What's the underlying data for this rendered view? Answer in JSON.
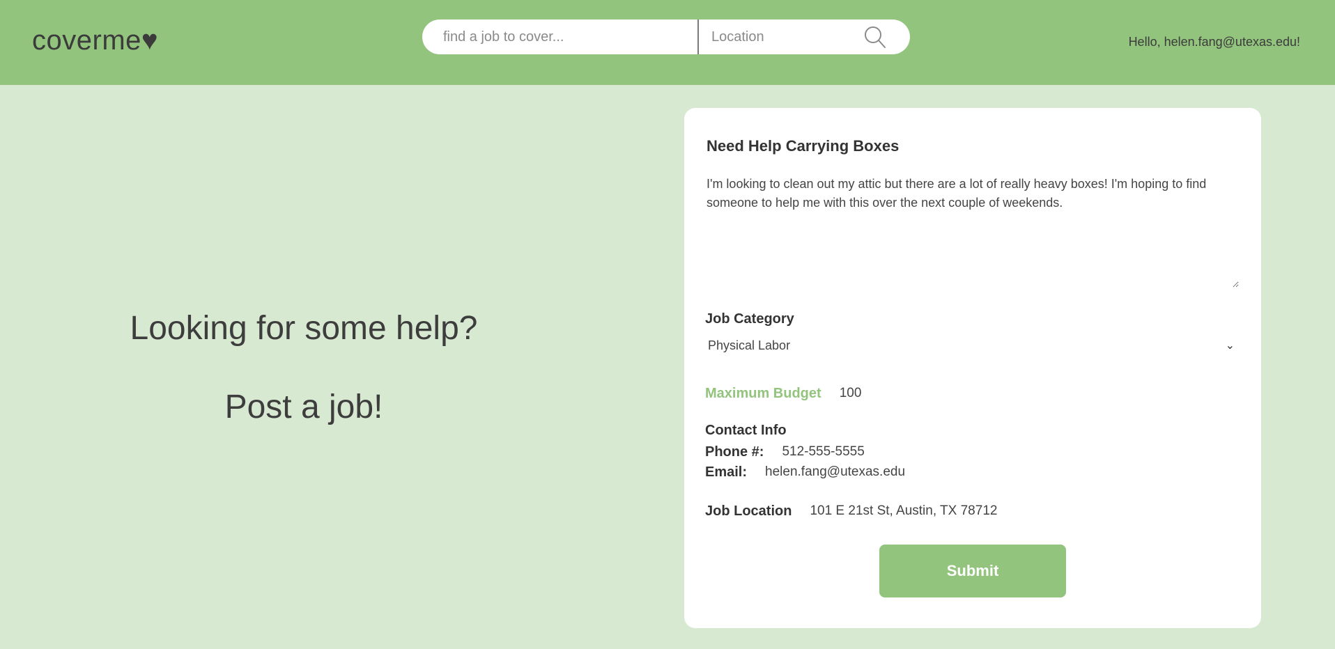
{
  "header": {
    "logo": "coverme♥",
    "search_placeholder": "find a job to cover...",
    "location_placeholder": "Location",
    "search_icon": "search-icon",
    "greeting": "Hello, helen.fang@utexas.edu!"
  },
  "hero": {
    "line1": "Looking for some help?",
    "line2": "Post a job!"
  },
  "form": {
    "title": "Need Help Carrying Boxes",
    "description": "I'm looking to clean out my attic but there are a lot of really heavy boxes! I'm hoping to find someone to help me with this over the next couple of weekends.",
    "category_label": "Job Category",
    "category_value": "Physical Labor",
    "budget_label": "Maximum Budget",
    "budget_value": "100",
    "contact_label": "Contact Info",
    "phone_label": "Phone #:",
    "phone_value": "512-555-5555",
    "email_label": "Email:",
    "email_value": "helen.fang@utexas.edu",
    "location_label": "Job Location",
    "location_value": "101 E 21st St, Austin, TX 78712",
    "submit_label": "Submit"
  },
  "colors": {
    "header_bg": "#93c47d",
    "page_bg": "#d8e9d2",
    "accent": "#93c47d",
    "card_bg": "#ffffff"
  }
}
